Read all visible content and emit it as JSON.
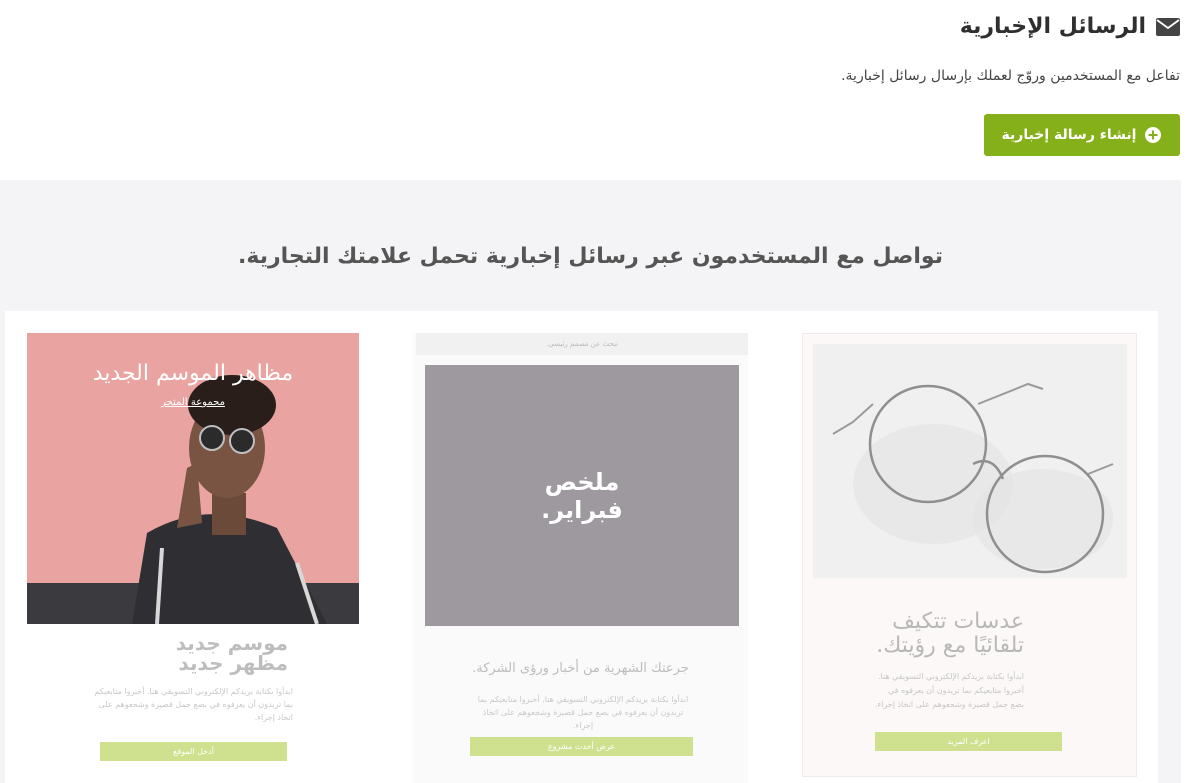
{
  "header": {
    "title": "الرسائل الإخبارية",
    "subtitle": "تفاعل مع المستخدمين وروّج لعملك بإرسال رسائل إخبارية.",
    "create_button_label": "إنشاء رسالة إخبارية"
  },
  "showcase": {
    "heading": "تواصل مع المستخدمون عبر رسائل إخبارية تحمل علامتك التجارية.",
    "cards": [
      {
        "title_line1": "عدسات تتكيف",
        "title_line2": "تلقائيًا مع رؤيتك.",
        "body": "ابدأوا بكتابة بريدكم الإلكتروني التسويقي هنا. أخبروا متابعيكم بما تريدون أن يعرفوه في بضع جمل قصيرة وشجعوهم على اتخاذ إجراء.",
        "button_label": "اعرف المزيد"
      },
      {
        "top_bar": "تبحث عن مصمم رئيسي.",
        "image_line1": "ملخص",
        "image_line2": "فبراير.",
        "heading": "جرعتك الشهرية من أخبار ورؤى الشركة.",
        "body": "ابدأوا بكتابة بريدكم الإلكتروني التسويقي هنا. أخبروا متابعيكم بما تريدون أن يعرفوه في بضع جمل قصيرة وشجعوهم على اتخاذ إجراء.",
        "button_label": "عرض أحدث مشروع"
      },
      {
        "image_title": "مظاهر الموسم الجديد",
        "image_link": "مجموعة المتجر",
        "heading_line1": "موسم جديد",
        "heading_line2": "مظهر جديد",
        "body": "ابدأوا بكتابة بريدكم الإلكتروني التسويقي هنا. أخبروا متابعيكم بما تريدون أن يعرفوه في بضع جمل قصيرة وشجعوهم على اتخاذ إجراء.",
        "button_label": "أدخل الموقع"
      }
    ]
  },
  "colors": {
    "accent": "#86b019",
    "button_faded": "#cfe08e",
    "fashion_bg": "#e9a4a2",
    "summary_bg": "#9d999e"
  },
  "icons": [
    "envelope-icon",
    "plus-circle-icon"
  ]
}
